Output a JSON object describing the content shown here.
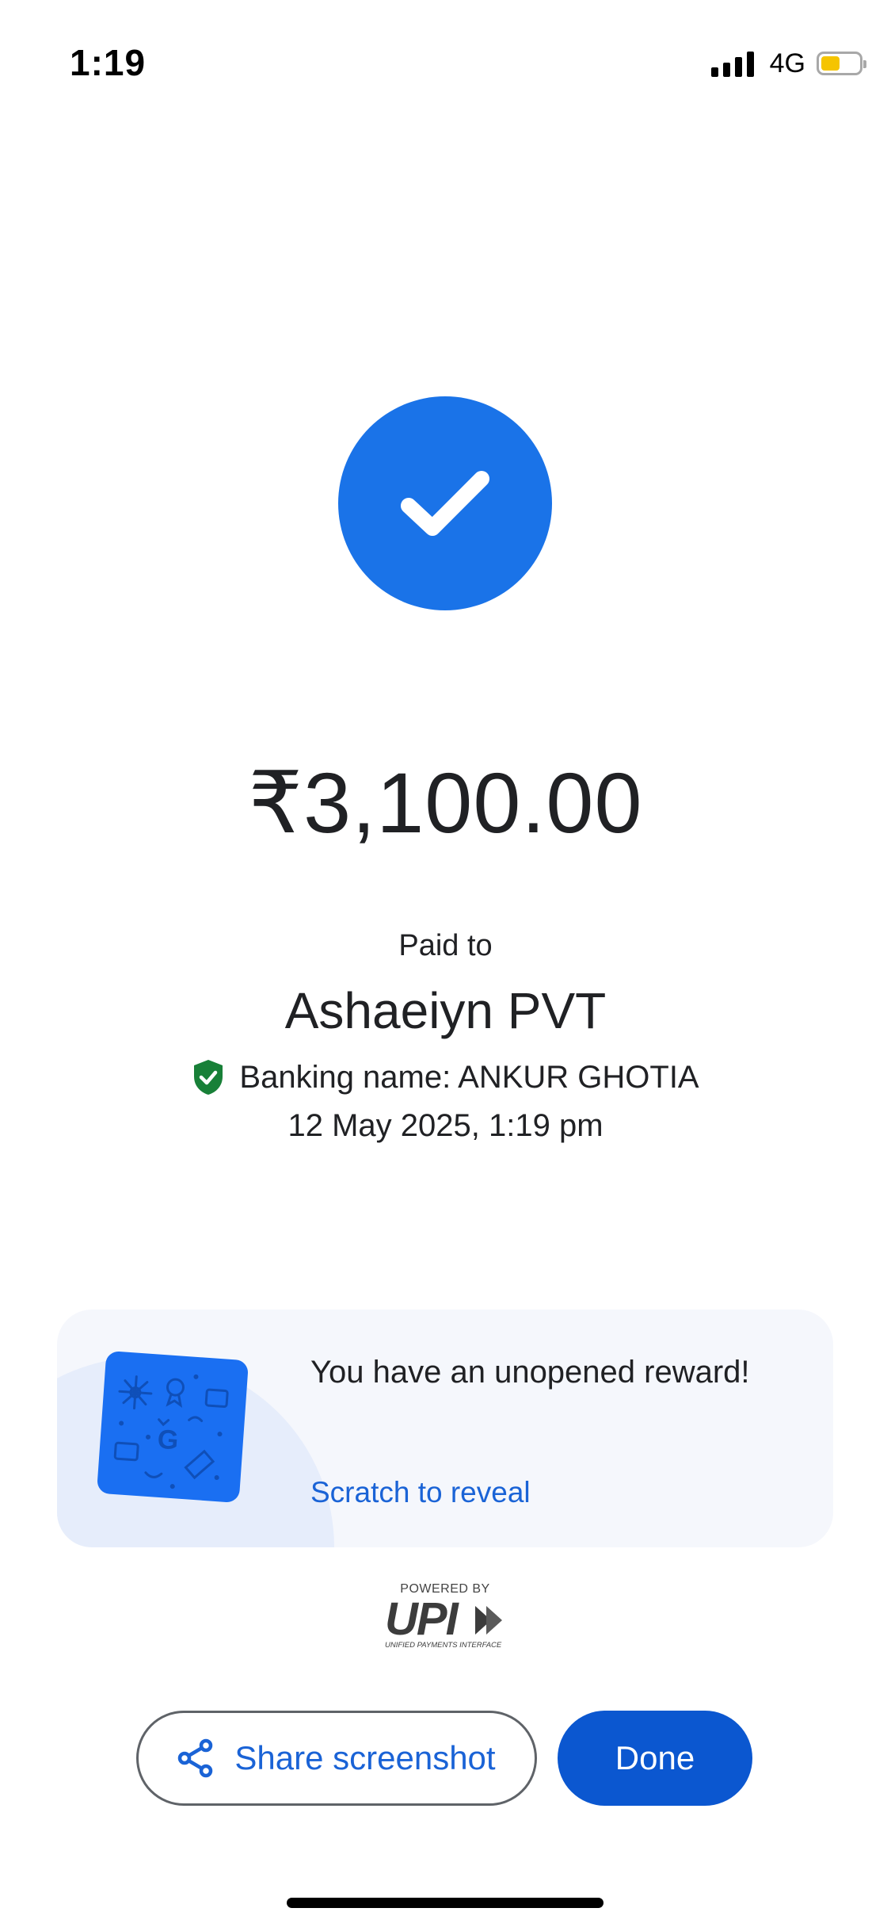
{
  "status_bar": {
    "time": "1:19",
    "network": "4G",
    "signal_bars": 4,
    "battery_level": 0.5,
    "battery_color": "#f5c400"
  },
  "success_icon": {
    "name": "check-icon",
    "color": "#1a73e8"
  },
  "payment": {
    "amount": "₹3,100.00",
    "paid_to_label": "Paid to",
    "payee_name": "Ashaeiyn PVT",
    "banking_name": "Banking name: ANKUR GHOTIA",
    "date_time": "12 May 2025, 1:19 pm",
    "verified_icon": "shield-check-icon"
  },
  "reward": {
    "title": "You have an unopened reward!",
    "action_label": "Scratch to reveal",
    "card_icon": "scratch-card-icon"
  },
  "upi": {
    "powered_by": "POWERED BY",
    "logo_text": "UPI",
    "tagline": "UNIFIED PAYMENTS INTERFACE"
  },
  "actions": {
    "share_label": "Share screenshot",
    "share_icon": "share-icon",
    "done_label": "Done"
  },
  "colors": {
    "primary_blue": "#1a73e8",
    "button_blue": "#0b57d0",
    "link_blue": "#1a63d6",
    "verified_green": "#188038",
    "card_background": "#f5f7fc"
  }
}
